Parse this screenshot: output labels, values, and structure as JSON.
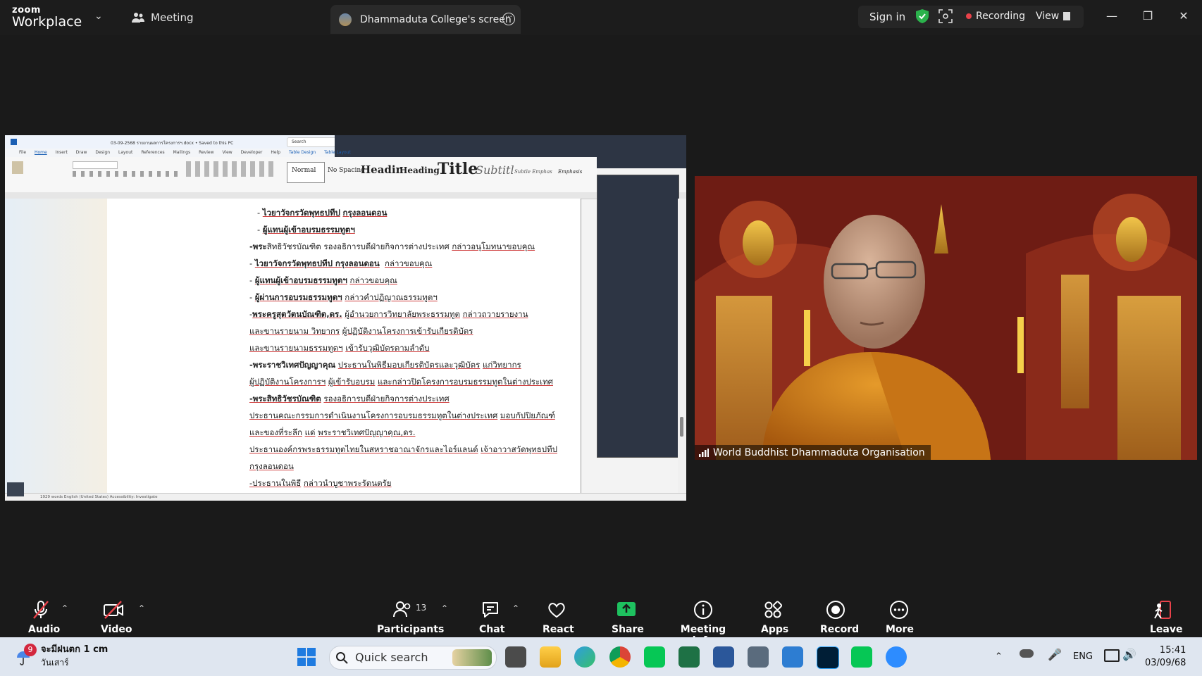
{
  "topbar": {
    "logo_top": "zoom",
    "logo_bottom": "Workplace",
    "meeting_label": "Meeting",
    "screen_tab_label": "Dhammaduta College's screen",
    "sign_in": "Sign in",
    "recording": "Recording",
    "view": "View"
  },
  "shared_document": {
    "title": "03-09-2568 รายงานผลการโครงการฯ.docx • Saved to this PC",
    "search": "Search",
    "tabs": [
      "File",
      "Home",
      "Insert",
      "Draw",
      "Design",
      "Layout",
      "References",
      "Mailings",
      "Review",
      "View",
      "Developer",
      "Help",
      "Table Design",
      "Table Layout"
    ],
    "styles": [
      "Normal",
      "No Spacing",
      "Headin",
      "Heading",
      "Title",
      "Subtitl",
      "Subtle Emphas",
      "Emphasis"
    ],
    "lines": [
      {
        "parts": [
          {
            "t": "   - ",
            "s": ""
          },
          {
            "t": "ไวยาวัจกรวัดพุทธปทีป",
            "s": "bu"
          },
          {
            "t": " ",
            "s": ""
          },
          {
            "t": "กรุงลอนดอน",
            "s": "bu"
          }
        ]
      },
      {
        "parts": [
          {
            "t": "   - ",
            "s": ""
          },
          {
            "t": "ผู้แทนผู้เข้าอบรมธรรมทูตฯ",
            "s": "bu"
          }
        ]
      },
      {
        "parts": [
          {
            "t": "-พระ",
            "s": "b"
          },
          {
            "t": "สิทธิวัชรบัณฑิต รองอธิการบดีฝ่ายกิจการต่างประเทศ ",
            "s": ""
          },
          {
            "t": "กล่าวอนุโมทนาขอบคุณ",
            "s": "u"
          }
        ]
      },
      {
        "parts": [
          {
            "t": "- ",
            "s": ""
          },
          {
            "t": "ไวยาวัจกรวัดพุทธปทีป กรุงลอนดอน",
            "s": "bu"
          },
          {
            "t": "  ",
            "s": ""
          },
          {
            "t": "กล่าวขอบคุณ",
            "s": "u"
          }
        ]
      },
      {
        "parts": [
          {
            "t": "- ",
            "s": ""
          },
          {
            "t": "ผู้แทนผู้เข้าอบรมธรรมทูตฯ",
            "s": "bu"
          },
          {
            "t": " ",
            "s": ""
          },
          {
            "t": "กล่าวขอบคุณ",
            "s": "u"
          }
        ]
      },
      {
        "parts": [
          {
            "t": "- ",
            "s": ""
          },
          {
            "t": "ผู้ผ่านการอบรมธรรมทูตฯ",
            "s": "bu"
          },
          {
            "t": " ",
            "s": ""
          },
          {
            "t": "กล่าวคำปฏิญาณธรรมทูตฯ",
            "s": "u"
          }
        ]
      },
      {
        "parts": [
          {
            "t": "-",
            "s": ""
          },
          {
            "t": "พระครูสุตวัตนบัณฑิต,ดร.",
            "s": "bu"
          },
          {
            "t": " ",
            "s": ""
          },
          {
            "t": "ผู้อำนวยการวิทยาลัยพระธรรมทูต",
            "s": "u"
          },
          {
            "t": " ",
            "s": ""
          },
          {
            "t": "กล่าวถวายรายงาน",
            "s": "u"
          }
        ]
      },
      {
        "parts": [
          {
            "t": "และขานรายนาม ",
            "s": "u"
          },
          {
            "t": "วิทยากร",
            "s": "u"
          },
          {
            "t": " ",
            "s": ""
          },
          {
            "t": "ผู้ปฏิบัติงานโครงการเข้ารับเกียรติบัตร",
            "s": "u"
          }
        ]
      },
      {
        "parts": [
          {
            "t": "และขานรายนามธรรมทูตฯ",
            "s": "u"
          },
          {
            "t": " ",
            "s": ""
          },
          {
            "t": "เข้ารับวุฒิบัตรตามลำดับ",
            "s": "u"
          }
        ]
      },
      {
        "parts": [
          {
            "t": "-พระราชวิเทศปัญญาคุณ",
            "s": "b"
          },
          {
            "t": " ",
            "s": ""
          },
          {
            "t": "ประธานในพิธีมอบเกียรติบัตรและวุฒิบัตร",
            "s": "u"
          },
          {
            "t": " ",
            "s": ""
          },
          {
            "t": "แก่วิทยากร",
            "s": "u"
          }
        ]
      },
      {
        "parts": [
          {
            "t": "ผู้ปฏิบัติงานโครงการฯ",
            "s": "u"
          },
          {
            "t": " ",
            "s": ""
          },
          {
            "t": "ผู้เข้ารับอบรม",
            "s": "u"
          },
          {
            "t": " ",
            "s": ""
          },
          {
            "t": "และกล่าวปิดโครงการอบรมธรรมทูตในต่างประเทศ",
            "s": "u"
          }
        ]
      },
      {
        "parts": [
          {
            "t": "-พระสิทธิวัชรบัณฑิต",
            "s": "bu"
          },
          {
            "t": " ",
            "s": ""
          },
          {
            "t": "รองอธิการบดีฝ่ายกิจการต่างประเทศ",
            "s": "u"
          }
        ]
      },
      {
        "parts": [
          {
            "t": "ประธานคณะกรรมการดำเนินงานโครงการอบรมธรรมทูตในต่างประเทศ",
            "s": "u"
          },
          {
            "t": " ",
            "s": ""
          },
          {
            "t": "มอบกัปปิยภัณฑ์",
            "s": "u"
          }
        ]
      },
      {
        "parts": [
          {
            "t": "และของที่ระลึก",
            "s": "u"
          },
          {
            "t": " ",
            "s": ""
          },
          {
            "t": "แด่",
            "s": "u"
          },
          {
            "t": " ",
            "s": ""
          },
          {
            "t": "พระราชวิเทศปัญญาคุณ,ดร.",
            "s": "u"
          }
        ]
      },
      {
        "parts": [
          {
            "t": "ประธานองค์กรพระธรรมทูตไทยในสหราชอาณาจักรและไอร์แลนด์",
            "s": "u"
          },
          {
            "t": " ",
            "s": ""
          },
          {
            "t": "เจ้าอาวาสวัดพุทธปทีป",
            "s": "u"
          }
        ]
      },
      {
        "parts": [
          {
            "t": "กรุงลอนดอน",
            "s": "u"
          }
        ]
      },
      {
        "parts": [
          {
            "t": "-ประธานในพิธี",
            "s": "u"
          },
          {
            "t": " ",
            "s": ""
          },
          {
            "t": "กล่าวนำบูชาพระรัตนตรัย",
            "s": "u"
          }
        ]
      }
    ],
    "status": "1929 words   English (United States)   Accessibility: Investigate"
  },
  "video": {
    "participant_name": "World Buddhist Dhammaduta Organisation"
  },
  "toolbar": {
    "audio": "Audio",
    "video": "Video",
    "participants": "Participants",
    "participants_count": "13",
    "chat": "Chat",
    "react": "React",
    "share": "Share",
    "meeting_info": "Meeting info",
    "apps": "Apps",
    "record": "Record",
    "more": "More",
    "leave": "Leave"
  },
  "taskbar": {
    "weather_badge": "9",
    "weather_line1": "จะมีฝนตก 1 cm",
    "weather_line2": "วันเสาร์",
    "search_placeholder": "Quick search",
    "lang": "ENG",
    "time": "15:41",
    "date": "03/09/68"
  },
  "colors": {
    "leave_red": "#e8424a",
    "share_green": "#1ec15f",
    "shield_green": "#2bb24c",
    "recording_red": "#e8424a"
  }
}
